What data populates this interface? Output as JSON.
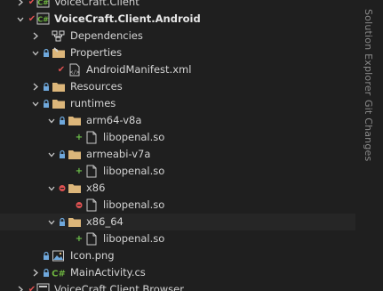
{
  "tree": {
    "items": [
      {
        "label": "VoiceCraft.Client"
      },
      {
        "label": "VoiceCraft.Client.Android"
      },
      {
        "label": "Dependencies"
      },
      {
        "label": "Properties"
      },
      {
        "label": "AndroidManifest.xml"
      },
      {
        "label": "Resources"
      },
      {
        "label": "runtimes"
      },
      {
        "label": "arm64-v8a"
      },
      {
        "label": "libopenal.so"
      },
      {
        "label": "armeabi-v7a"
      },
      {
        "label": "libopenal.so"
      },
      {
        "label": "x86"
      },
      {
        "label": "libopenal.so"
      },
      {
        "label": "x86_64"
      },
      {
        "label": "libopenal.so"
      },
      {
        "label": "Icon.png"
      },
      {
        "label": "MainActivity.cs"
      },
      {
        "label": "VoiceCraft.Client.Browser"
      }
    ]
  },
  "side_tabs": {
    "solution_explorer": "Solution Explorer",
    "git_changes": "Git Changes"
  },
  "colors": {
    "background": "#1f1f1f",
    "folder": "#dcb67a",
    "checkin_red": "#e05252",
    "add_green": "#6cc04a",
    "lock_blue": "#6fa8dc",
    "csharp_green": "#6db33f"
  }
}
